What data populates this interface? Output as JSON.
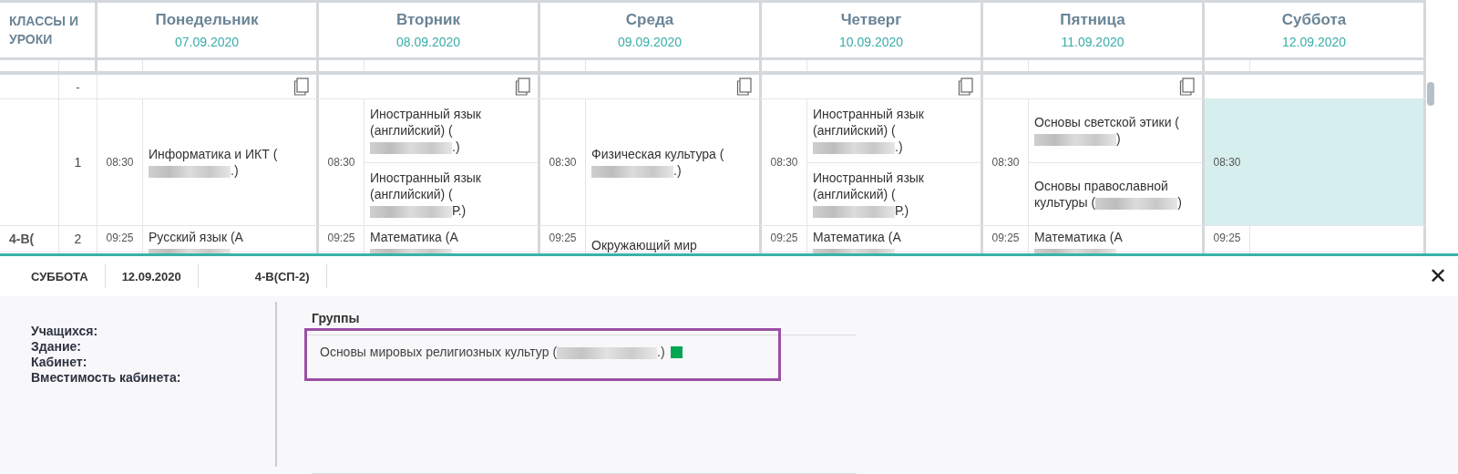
{
  "schedule": {
    "corner_header": "КЛАССЫ И УРОКИ",
    "days": [
      {
        "name": "Понедельник",
        "date": "07.09.2020",
        "copy": true
      },
      {
        "name": "Вторник",
        "date": "08.09.2020",
        "copy": true
      },
      {
        "name": "Среда",
        "date": "09.09.2020",
        "copy": true
      },
      {
        "name": "Четверг",
        "date": "10.09.2020",
        "copy": true
      },
      {
        "name": "Пятница",
        "date": "11.09.2020",
        "copy": true
      },
      {
        "name": "Суббота",
        "date": "12.09.2020",
        "copy": false
      }
    ],
    "zero_row": {
      "number": "-"
    },
    "rows": [
      {
        "class_label": "",
        "number": "1",
        "slots": [
          {
            "time": "08:30",
            "highlighted": false,
            "lessons": [
              {
                "text": "Информатика и ИКТ (",
                "redacted": true,
                "tail": ".)"
              }
            ]
          },
          {
            "time": "08:30",
            "highlighted": false,
            "lessons": [
              {
                "text": "Иностранный язык (английский) (",
                "redacted": true,
                "tail": ".)"
              },
              {
                "text": "Иностранный язык (английский) (",
                "redacted": true,
                "tail": "Р.)"
              }
            ]
          },
          {
            "time": "08:30",
            "highlighted": false,
            "lessons": [
              {
                "text": "Физическая культура (",
                "redacted": true,
                "tail": ".)"
              }
            ]
          },
          {
            "time": "08:30",
            "highlighted": false,
            "lessons": [
              {
                "text": "Иностранный язык (английский) (",
                "redacted": true,
                "tail": ".)"
              },
              {
                "text": "Иностранный язык (английский) (",
                "redacted": true,
                "tail": "Р.)"
              }
            ]
          },
          {
            "time": "08:30",
            "highlighted": false,
            "lessons": [
              {
                "text": "Основы светской этики (",
                "redacted": true,
                "tail": ")"
              },
              {
                "text": "Основы православной культуры (",
                "redacted": true,
                "tail": ")"
              }
            ]
          },
          {
            "time": "08:30",
            "highlighted": true
          }
        ]
      },
      {
        "class_label": "4-В(",
        "number": "2",
        "slots": [
          {
            "time": "09:25",
            "highlighted": false,
            "lessons": [
              {
                "text": "Русский язык (А",
                "redacted": true
              }
            ]
          },
          {
            "time": "09:25",
            "highlighted": false,
            "lessons": [
              {
                "text": "Математика (А",
                "redacted": true
              }
            ]
          },
          {
            "time": "09:25",
            "highlighted": false,
            "lessons": [
              {
                "text": "Окружающий мир",
                "redacted": false
              }
            ]
          },
          {
            "time": "09:25",
            "highlighted": false,
            "lessons": [
              {
                "text": "Математика (А",
                "redacted": true
              }
            ]
          },
          {
            "time": "09:25",
            "highlighted": false,
            "lessons": [
              {
                "text": "Математика (А",
                "redacted": true
              }
            ]
          },
          {
            "time": "09:25",
            "highlighted": false
          }
        ]
      }
    ]
  },
  "details": {
    "tabs": [
      "СУББОТА",
      "12.09.2020",
      "4-В(СП-2)"
    ],
    "close": "✕",
    "fields": [
      "Учащихся:",
      "Здание:",
      "Кабинет:",
      "Вместимость кабинета:"
    ],
    "groups_title": "Группы",
    "groups": [
      {
        "text": "Основы мировых религиозных культур (",
        "redacted": true,
        "tail": ".)",
        "selected": true,
        "color": "#00a651"
      }
    ]
  }
}
